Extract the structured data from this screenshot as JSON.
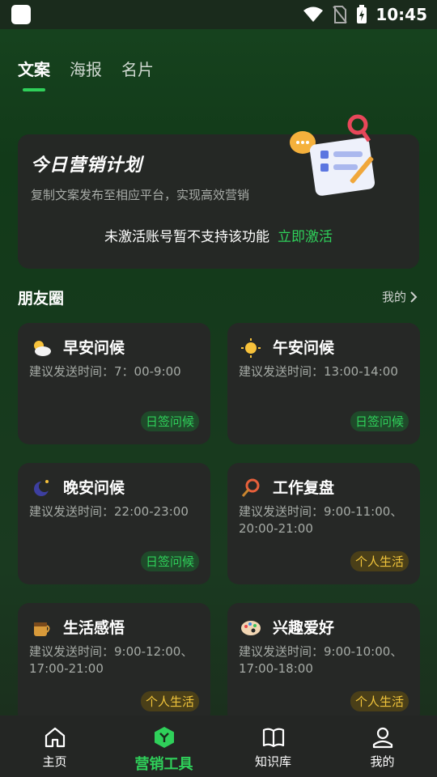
{
  "status_bar": {
    "time": "10:45"
  },
  "tabs": [
    {
      "label": "文案",
      "active": true
    },
    {
      "label": "海报",
      "active": false
    },
    {
      "label": "名片",
      "active": false
    }
  ],
  "plan": {
    "title": "今日营销计划",
    "subtitle": "复制文案发布至相应平台，实现高效营销",
    "notice": "未激活账号暂不支持该功能",
    "activate_label": "立即激活"
  },
  "section": {
    "title": "朋友圈",
    "more_label": "我的"
  },
  "cards": [
    {
      "title": "早安问候",
      "desc": "建议发送时间：7：00-9:00",
      "badge": "日签问候",
      "badge_type": "green",
      "icon": "cloud-sun-icon"
    },
    {
      "title": "午安问候",
      "desc": "建议发送时间：13:00-14:00",
      "badge": "日签问候",
      "badge_type": "green",
      "icon": "sun-icon"
    },
    {
      "title": "晚安问候",
      "desc": "建议发送时间：22:00-23:00",
      "badge": "日签问候",
      "badge_type": "green",
      "icon": "moon-icon"
    },
    {
      "title": "工作复盘",
      "desc": "建议发送时间：9:00-11:00、20:00-21:00",
      "badge": "个人生活",
      "badge_type": "gold",
      "icon": "magnifier-icon"
    },
    {
      "title": "生活感悟",
      "desc": "建议发送时间：9:00-12:00、17:00-21:00",
      "badge": "个人生活",
      "badge_type": "gold",
      "icon": "coffee-cup-icon"
    },
    {
      "title": "兴趣爱好",
      "desc": "建议发送时间：9:00-10:00、17:00-18:00",
      "badge": "个人生活",
      "badge_type": "gold",
      "icon": "palette-icon"
    }
  ],
  "bottom_nav": [
    {
      "label": "主页",
      "icon": "home-icon",
      "active": false
    },
    {
      "label": "营销工具",
      "icon": "marketing-hex-icon",
      "active": true
    },
    {
      "label": "知识库",
      "icon": "book-icon",
      "active": false
    },
    {
      "label": "我的",
      "icon": "user-icon",
      "active": false
    }
  ],
  "colors": {
    "accent": "#2fd05a",
    "gold": "#f0c43b",
    "card": "#262826",
    "background": "#17441f"
  }
}
